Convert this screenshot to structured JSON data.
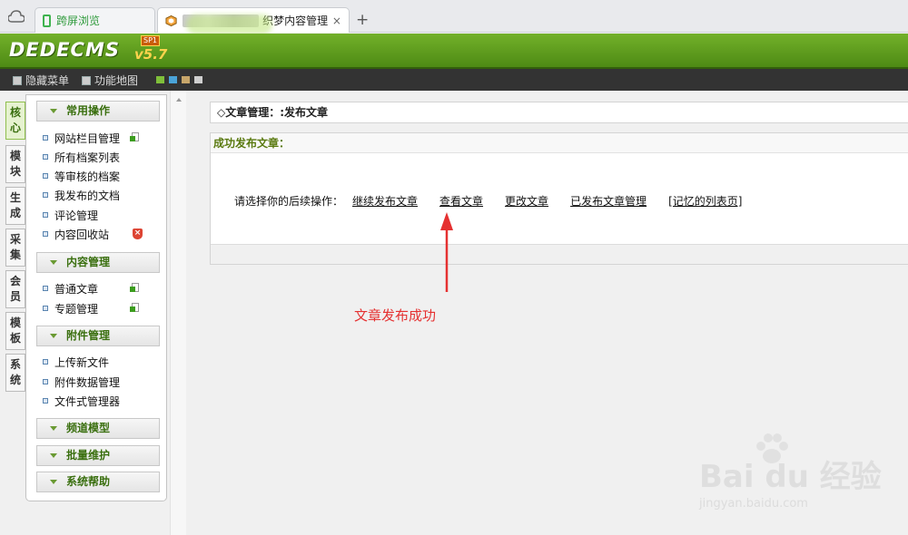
{
  "browser": {
    "tabs": [
      {
        "label": "跨屏浏览"
      },
      {
        "label": "织梦内容管理"
      }
    ],
    "new_tab": "+",
    "close": "×"
  },
  "header": {
    "logo": "DEDECMS",
    "version": "v5.7",
    "edition": "SP1"
  },
  "toolbar": {
    "items": [
      "隐藏菜单",
      "功能地图"
    ],
    "swatches": [
      "#7fbf3a",
      "#4aa3d8",
      "#c7a66a",
      "#cfcfcf"
    ]
  },
  "vtabs": [
    {
      "label": "核心"
    },
    {
      "label": "模块"
    },
    {
      "label": "生成"
    },
    {
      "label": "采集"
    },
    {
      "label": "会员"
    },
    {
      "label": "模板"
    },
    {
      "label": "系统"
    }
  ],
  "sidebar": {
    "sections": [
      {
        "title": "常用操作",
        "items": [
          "网站栏目管理",
          "所有档案列表",
          "等审核的档案",
          "我发布的文档",
          "评论管理",
          "内容回收站"
        ]
      },
      {
        "title": "内容管理",
        "items": [
          "普通文章",
          "专题管理"
        ]
      },
      {
        "title": "附件管理",
        "items": [
          "上传新文件",
          "附件数据管理",
          "文件式管理器"
        ]
      },
      {
        "title": "频道模型",
        "items": []
      },
      {
        "title": "批量维护",
        "items": []
      },
      {
        "title": "系统帮助",
        "items": []
      }
    ]
  },
  "main": {
    "title": "◇文章管理：:发布文章",
    "panel_head": "成功发布文章：",
    "ops_prompt": "请选择你的后续操作：",
    "ops": [
      "继续发布文章",
      "查看文章",
      "更改文章",
      "已发布文章管理",
      "[记忆的列表页]"
    ]
  },
  "annotation": "文章发布成功",
  "watermark": {
    "brand": "Bai du 经验",
    "url": "jingyan.baidu.com"
  },
  "colors": {
    "brand_green": "#5b9a1c",
    "annotation_red": "#e53131"
  }
}
